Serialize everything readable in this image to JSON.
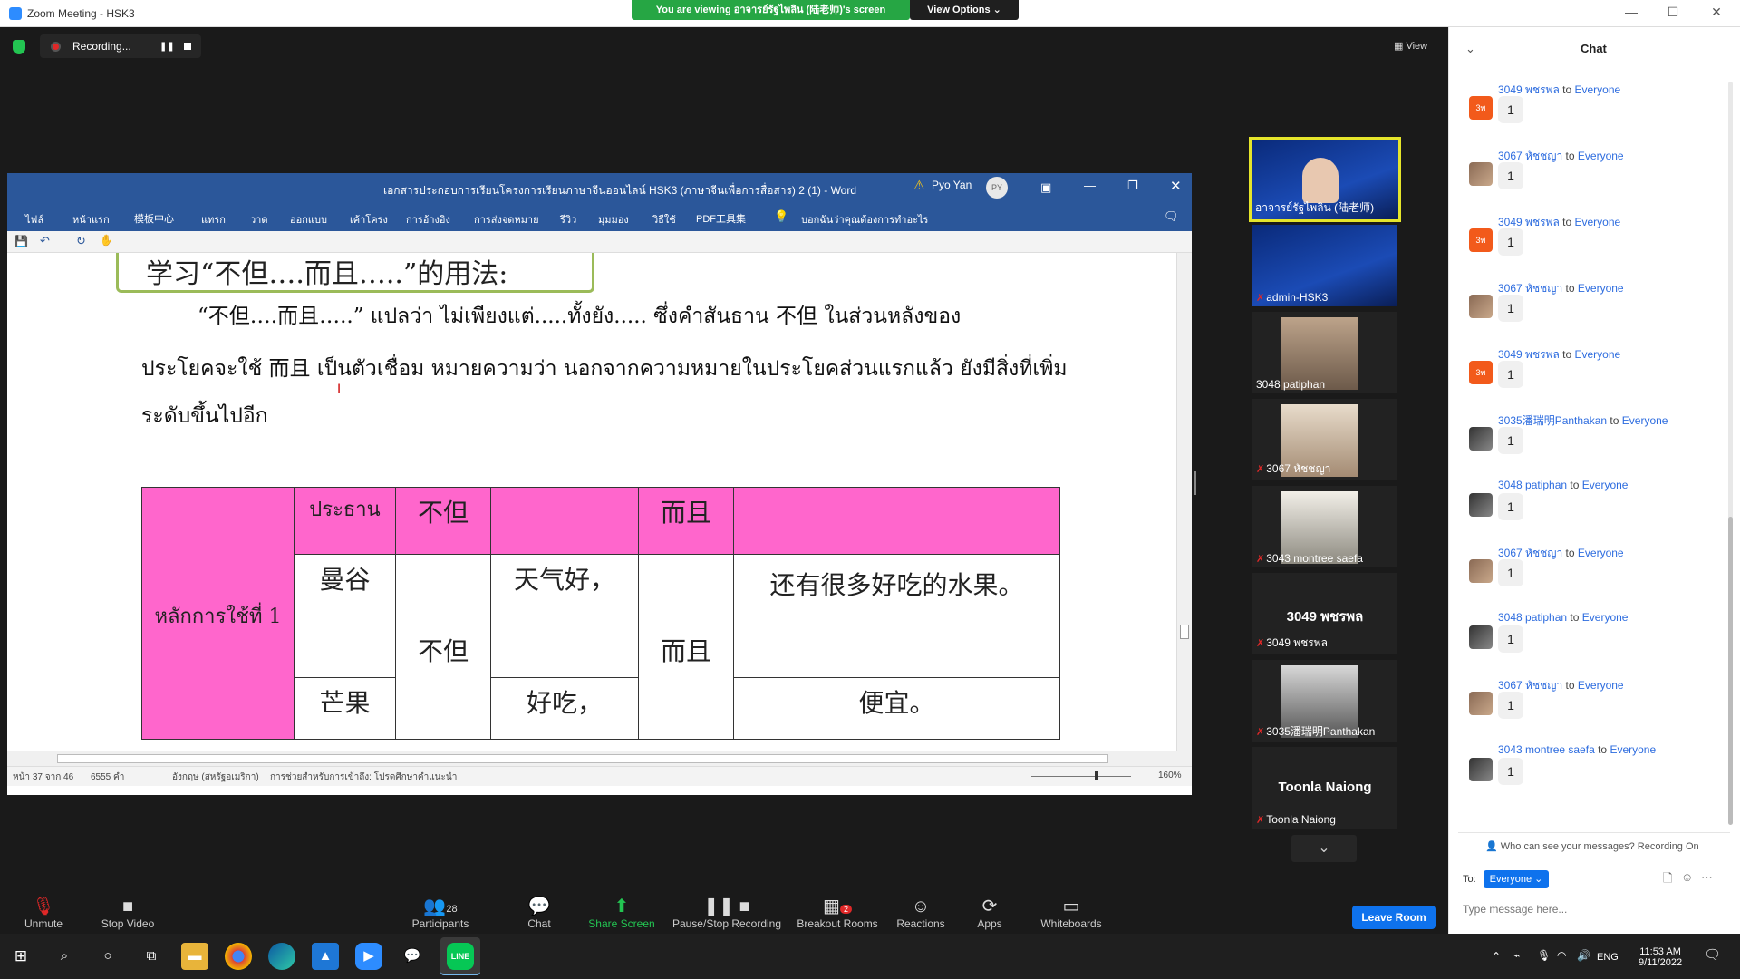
{
  "window": {
    "title": "Zoom Meeting - HSK3",
    "viewing_banner": "You are viewing อาจารย์รัฐไพลิน (陆老师)'s screen",
    "view_options": "View Options ⌄",
    "minimize": "—",
    "maximize": "☐",
    "close": "✕"
  },
  "recording": {
    "label": "Recording...",
    "pause": "❚❚"
  },
  "view_button": "▦ View",
  "word": {
    "doc_title": "เอกสารประกอบการเรียนโครงการเรียนภาษาจีนออนไลน์ HSK3 (ภาษาจีนเพื่อการสื่อสาร) 2 (1)  -  Word",
    "user_name": "Pyo Yan",
    "user_initials": "PY",
    "ribbon_tabs": [
      "ไฟล์",
      "หน้าแรก",
      "模板中心",
      "แทรก",
      "วาด",
      "ออกแบบ",
      "เค้าโครง",
      "การอ้างอิง",
      "การส่งจดหมาย",
      "รีวิว",
      "มุมมอง",
      "วิธีใช้",
      "PDF工具集",
      "บอกฉันว่าคุณต้องการทำอะไร"
    ],
    "heading": "学习“不但….而且…..”的用法:",
    "para_line1": "“不但….而且…..” แปลว่า ไม่เพียงแต่.....ทั้งยัง..... ซึ่งคำสันธาน 不但 ในส่วนหลังของ",
    "para_line2": "ประโยคจะใช้ 而且 เป็นตัวเชื่อม หมายความว่า นอกจากความหมายในประโยคส่วนแรกแล้ว ยังมีสิ่งที่เพิ่ม",
    "para_line3": "ระดับขึ้นไปอีก",
    "table": {
      "head": [
        "ประธาน",
        "不但",
        "",
        "而且",
        ""
      ],
      "rule_label": "หลักการใช้ที่ 1",
      "row1": [
        "曼谷",
        "不但",
        "天气好，",
        "而且",
        "还有很多好吃的水果。"
      ],
      "row2": [
        "芒果",
        "好吃，",
        "便宜。"
      ]
    },
    "status": {
      "page": "หน้า 37 จาก 46",
      "words": "6555 คำ",
      "language": "อังกฤษ (สหรัฐอเมริกา)",
      "accessibility": "การช่วยสำหรับการเข้าถึง: โปรดศึกษาคำแนะนำ",
      "zoom": "160%"
    }
  },
  "participants": [
    {
      "name": "อาจารย์รัฐไพลิน (陆老师)",
      "type": "slide",
      "muted": false
    },
    {
      "name": "admin-HSK3",
      "type": "slide",
      "muted": true
    },
    {
      "name": "3048 patiphan",
      "type": "video",
      "muted": false
    },
    {
      "name": "3067 หัชชญา",
      "type": "video",
      "muted": true
    },
    {
      "name": "3043 montree saefa",
      "type": "video",
      "muted": true
    },
    {
      "name": "3049 พชรพล",
      "type": "name",
      "big": "3049 พชรพล",
      "muted": true
    },
    {
      "name": "3035潘瑞明Panthakan",
      "type": "video",
      "muted": true
    },
    {
      "name": "Toonla Naiong",
      "type": "name",
      "big": "Toonla Naiong",
      "muted": true
    }
  ],
  "toolbar": {
    "unmute": "Unmute",
    "stop_video": "Stop Video",
    "participants": "Participants",
    "participants_count": "28",
    "chat": "Chat",
    "share_screen": "Share Screen",
    "pause_stop_recording": "Pause/Stop Recording",
    "breakout_rooms": "Breakout Rooms",
    "breakout_badge": "2",
    "reactions": "Reactions",
    "apps": "Apps",
    "whiteboards": "Whiteboards",
    "leave_room": "Leave Room"
  },
  "chat": {
    "title": "Chat",
    "messages": [
      {
        "from": "3049 พชรพล",
        "to": "Everyone",
        "text": "1",
        "avatar": "3พ"
      },
      {
        "from": "3067 หัชชญา",
        "to": "Everyone",
        "text": "1",
        "avatar": ""
      },
      {
        "from": "3049 พชรพล",
        "to": "Everyone",
        "text": "1",
        "avatar": "3พ"
      },
      {
        "from": "3067 หัชชญา",
        "to": "Everyone",
        "text": "1",
        "avatar": ""
      },
      {
        "from": "3049 พชรพล",
        "to": "Everyone",
        "text": "1",
        "avatar": "3พ"
      },
      {
        "from": "3035潘瑞明Panthakan",
        "to": "Everyone",
        "text": "1",
        "avatar": ""
      },
      {
        "from": "3048 patiphan",
        "to": "Everyone",
        "text": "1",
        "avatar": ""
      },
      {
        "from": "3067 หัชชญา",
        "to": "Everyone",
        "text": "1",
        "avatar": ""
      },
      {
        "from": "3048 patiphan",
        "to": "Everyone",
        "text": "1",
        "avatar": ""
      },
      {
        "from": "3067 หัชชญา",
        "to": "Everyone",
        "text": "1",
        "avatar": ""
      },
      {
        "from": "3043 montree saefa",
        "to": "Everyone",
        "text": "1",
        "avatar": ""
      }
    ],
    "to_word": "to",
    "notice": "Who can see your messages? Recording On",
    "to_label": "To:",
    "recipient": "Everyone ⌄",
    "placeholder": "Type message here..."
  },
  "taskbar": {
    "time": "11:53 AM",
    "date": "9/11/2022",
    "lang": "ENG",
    "icons": [
      "windows-start-icon",
      "search-icon",
      "cortana-icon",
      "task-view-icon",
      "file-explorer-icon",
      "chrome-icon",
      "edge-icon",
      "photos-icon",
      "zoom-icon",
      "wechat-icon",
      "line-icon"
    ]
  }
}
